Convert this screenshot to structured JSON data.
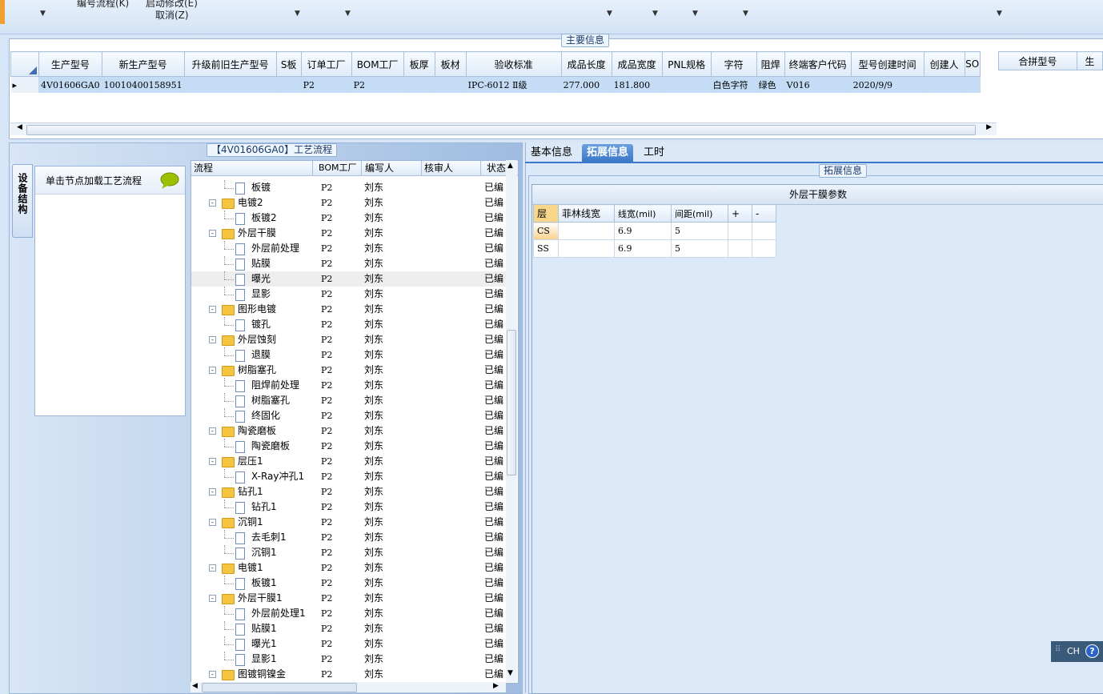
{
  "toolbar": {
    "item1": "编号流程(K)",
    "item2": "启动修改(E)",
    "item3": "取消(Z)"
  },
  "main_info": {
    "title": "主要信息",
    "columns": [
      "生产型号",
      "新生产型号",
      "升级前旧生产型号",
      "S板",
      "订单工厂",
      "BOM工厂",
      "板厚",
      "板材",
      "验收标准",
      "成品长度",
      "成品宽度",
      "PNL规格",
      "字符",
      "阻焊",
      "终端客户代码",
      "型号创建时间",
      "创建人",
      "SO"
    ],
    "row": [
      "4V01606GA0",
      "10010400158951",
      "",
      "",
      "P2",
      "P2",
      "",
      "",
      "IPC-6012 Ⅱ级",
      "277.000",
      "181.800",
      "",
      "白色字符",
      "绿色",
      "V016",
      "2020/9/9",
      "",
      ""
    ],
    "right_columns": [
      "合拼型号",
      "生"
    ]
  },
  "flow": {
    "title": "【4V01606GA0】工艺流程",
    "vertical_tab": "设备结构",
    "node_hint": "单击节点加载工艺流程",
    "columns": [
      "流程",
      "BOM工厂",
      "编写人",
      "核审人",
      "状态"
    ],
    "rows": [
      {
        "level": 1,
        "type": "doc",
        "name": "板镀",
        "bom": "P2",
        "writer": "刘东",
        "status": "已编"
      },
      {
        "level": 0,
        "type": "folder",
        "name": "电镀2",
        "bom": "P2",
        "writer": "刘东",
        "status": "已编"
      },
      {
        "level": 1,
        "type": "doc",
        "name": "板镀2",
        "bom": "P2",
        "writer": "刘东",
        "status": "已编"
      },
      {
        "level": 0,
        "type": "folder",
        "name": "外层干膜",
        "bom": "P2",
        "writer": "刘东",
        "status": "已编"
      },
      {
        "level": 1,
        "type": "doc",
        "name": "外层前处理",
        "bom": "P2",
        "writer": "刘东",
        "status": "已编"
      },
      {
        "level": 1,
        "type": "doc",
        "name": "贴膜",
        "bom": "P2",
        "writer": "刘东",
        "status": "已编"
      },
      {
        "level": 1,
        "type": "doc",
        "name": "曝光",
        "bom": "P2",
        "writer": "刘东",
        "status": "已编",
        "selected": true
      },
      {
        "level": 1,
        "type": "doc",
        "name": "显影",
        "bom": "P2",
        "writer": "刘东",
        "status": "已编"
      },
      {
        "level": 0,
        "type": "folder",
        "name": "图形电镀",
        "bom": "P2",
        "writer": "刘东",
        "status": "已编"
      },
      {
        "level": 1,
        "type": "doc",
        "name": "镀孔",
        "bom": "P2",
        "writer": "刘东",
        "status": "已编"
      },
      {
        "level": 0,
        "type": "folder",
        "name": "外层蚀刻",
        "bom": "P2",
        "writer": "刘东",
        "status": "已编"
      },
      {
        "level": 1,
        "type": "doc",
        "name": "退膜",
        "bom": "P2",
        "writer": "刘东",
        "status": "已编"
      },
      {
        "level": 0,
        "type": "folder",
        "name": "树脂塞孔",
        "bom": "P2",
        "writer": "刘东",
        "status": "已编"
      },
      {
        "level": 1,
        "type": "doc",
        "name": "阻焊前处理",
        "bom": "P2",
        "writer": "刘东",
        "status": "已编"
      },
      {
        "level": 1,
        "type": "doc",
        "name": "树脂塞孔",
        "bom": "P2",
        "writer": "刘东",
        "status": "已编"
      },
      {
        "level": 1,
        "type": "doc",
        "name": "终固化",
        "bom": "P2",
        "writer": "刘东",
        "status": "已编"
      },
      {
        "level": 0,
        "type": "folder",
        "name": "陶瓷磨板",
        "bom": "P2",
        "writer": "刘东",
        "status": "已编"
      },
      {
        "level": 1,
        "type": "doc",
        "name": "陶瓷磨板",
        "bom": "P2",
        "writer": "刘东",
        "status": "已编"
      },
      {
        "level": 0,
        "type": "folder",
        "name": "层压1",
        "bom": "P2",
        "writer": "刘东",
        "status": "已编"
      },
      {
        "level": 1,
        "type": "doc",
        "name": "X-Ray冲孔1",
        "bom": "P2",
        "writer": "刘东",
        "status": "已编"
      },
      {
        "level": 0,
        "type": "folder",
        "name": "钻孔1",
        "bom": "P2",
        "writer": "刘东",
        "status": "已编"
      },
      {
        "level": 1,
        "type": "doc",
        "name": "钻孔1",
        "bom": "P2",
        "writer": "刘东",
        "status": "已编"
      },
      {
        "level": 0,
        "type": "folder",
        "name": "沉铜1",
        "bom": "P2",
        "writer": "刘东",
        "status": "已编"
      },
      {
        "level": 1,
        "type": "doc",
        "name": "去毛刺1",
        "bom": "P2",
        "writer": "刘东",
        "status": "已编"
      },
      {
        "level": 1,
        "type": "doc",
        "name": "沉铜1",
        "bom": "P2",
        "writer": "刘东",
        "status": "已编"
      },
      {
        "level": 0,
        "type": "folder",
        "name": "电镀1",
        "bom": "P2",
        "writer": "刘东",
        "status": "已编"
      },
      {
        "level": 1,
        "type": "doc",
        "name": "板镀1",
        "bom": "P2",
        "writer": "刘东",
        "status": "已编"
      },
      {
        "level": 0,
        "type": "folder",
        "name": "外层干膜1",
        "bom": "P2",
        "writer": "刘东",
        "status": "已编"
      },
      {
        "level": 1,
        "type": "doc",
        "name": "外层前处理1",
        "bom": "P2",
        "writer": "刘东",
        "status": "已编"
      },
      {
        "level": 1,
        "type": "doc",
        "name": "贴膜1",
        "bom": "P2",
        "writer": "刘东",
        "status": "已编"
      },
      {
        "level": 1,
        "type": "doc",
        "name": "曝光1",
        "bom": "P2",
        "writer": "刘东",
        "status": "已编"
      },
      {
        "level": 1,
        "type": "doc",
        "name": "显影1",
        "bom": "P2",
        "writer": "刘东",
        "status": "已编"
      },
      {
        "level": 0,
        "type": "folder",
        "name": "图镀铜镍金",
        "bom": "P2",
        "writer": "刘东",
        "status": "已编"
      }
    ]
  },
  "tabs": [
    "基本信息",
    "拓展信息",
    "工时"
  ],
  "ext": {
    "title": "拓展信息",
    "table_title": "外层干膜参数",
    "columns": [
      "层",
      "菲林线宽",
      "线宽(mil)",
      "间距(mil)",
      "+",
      "-"
    ],
    "rows": [
      [
        "CS",
        "",
        "6.9",
        "5",
        "",
        ""
      ],
      [
        "SS",
        "",
        "6.9",
        "5",
        "",
        ""
      ]
    ]
  },
  "langbar": {
    "text": "CH",
    "help": "?"
  }
}
